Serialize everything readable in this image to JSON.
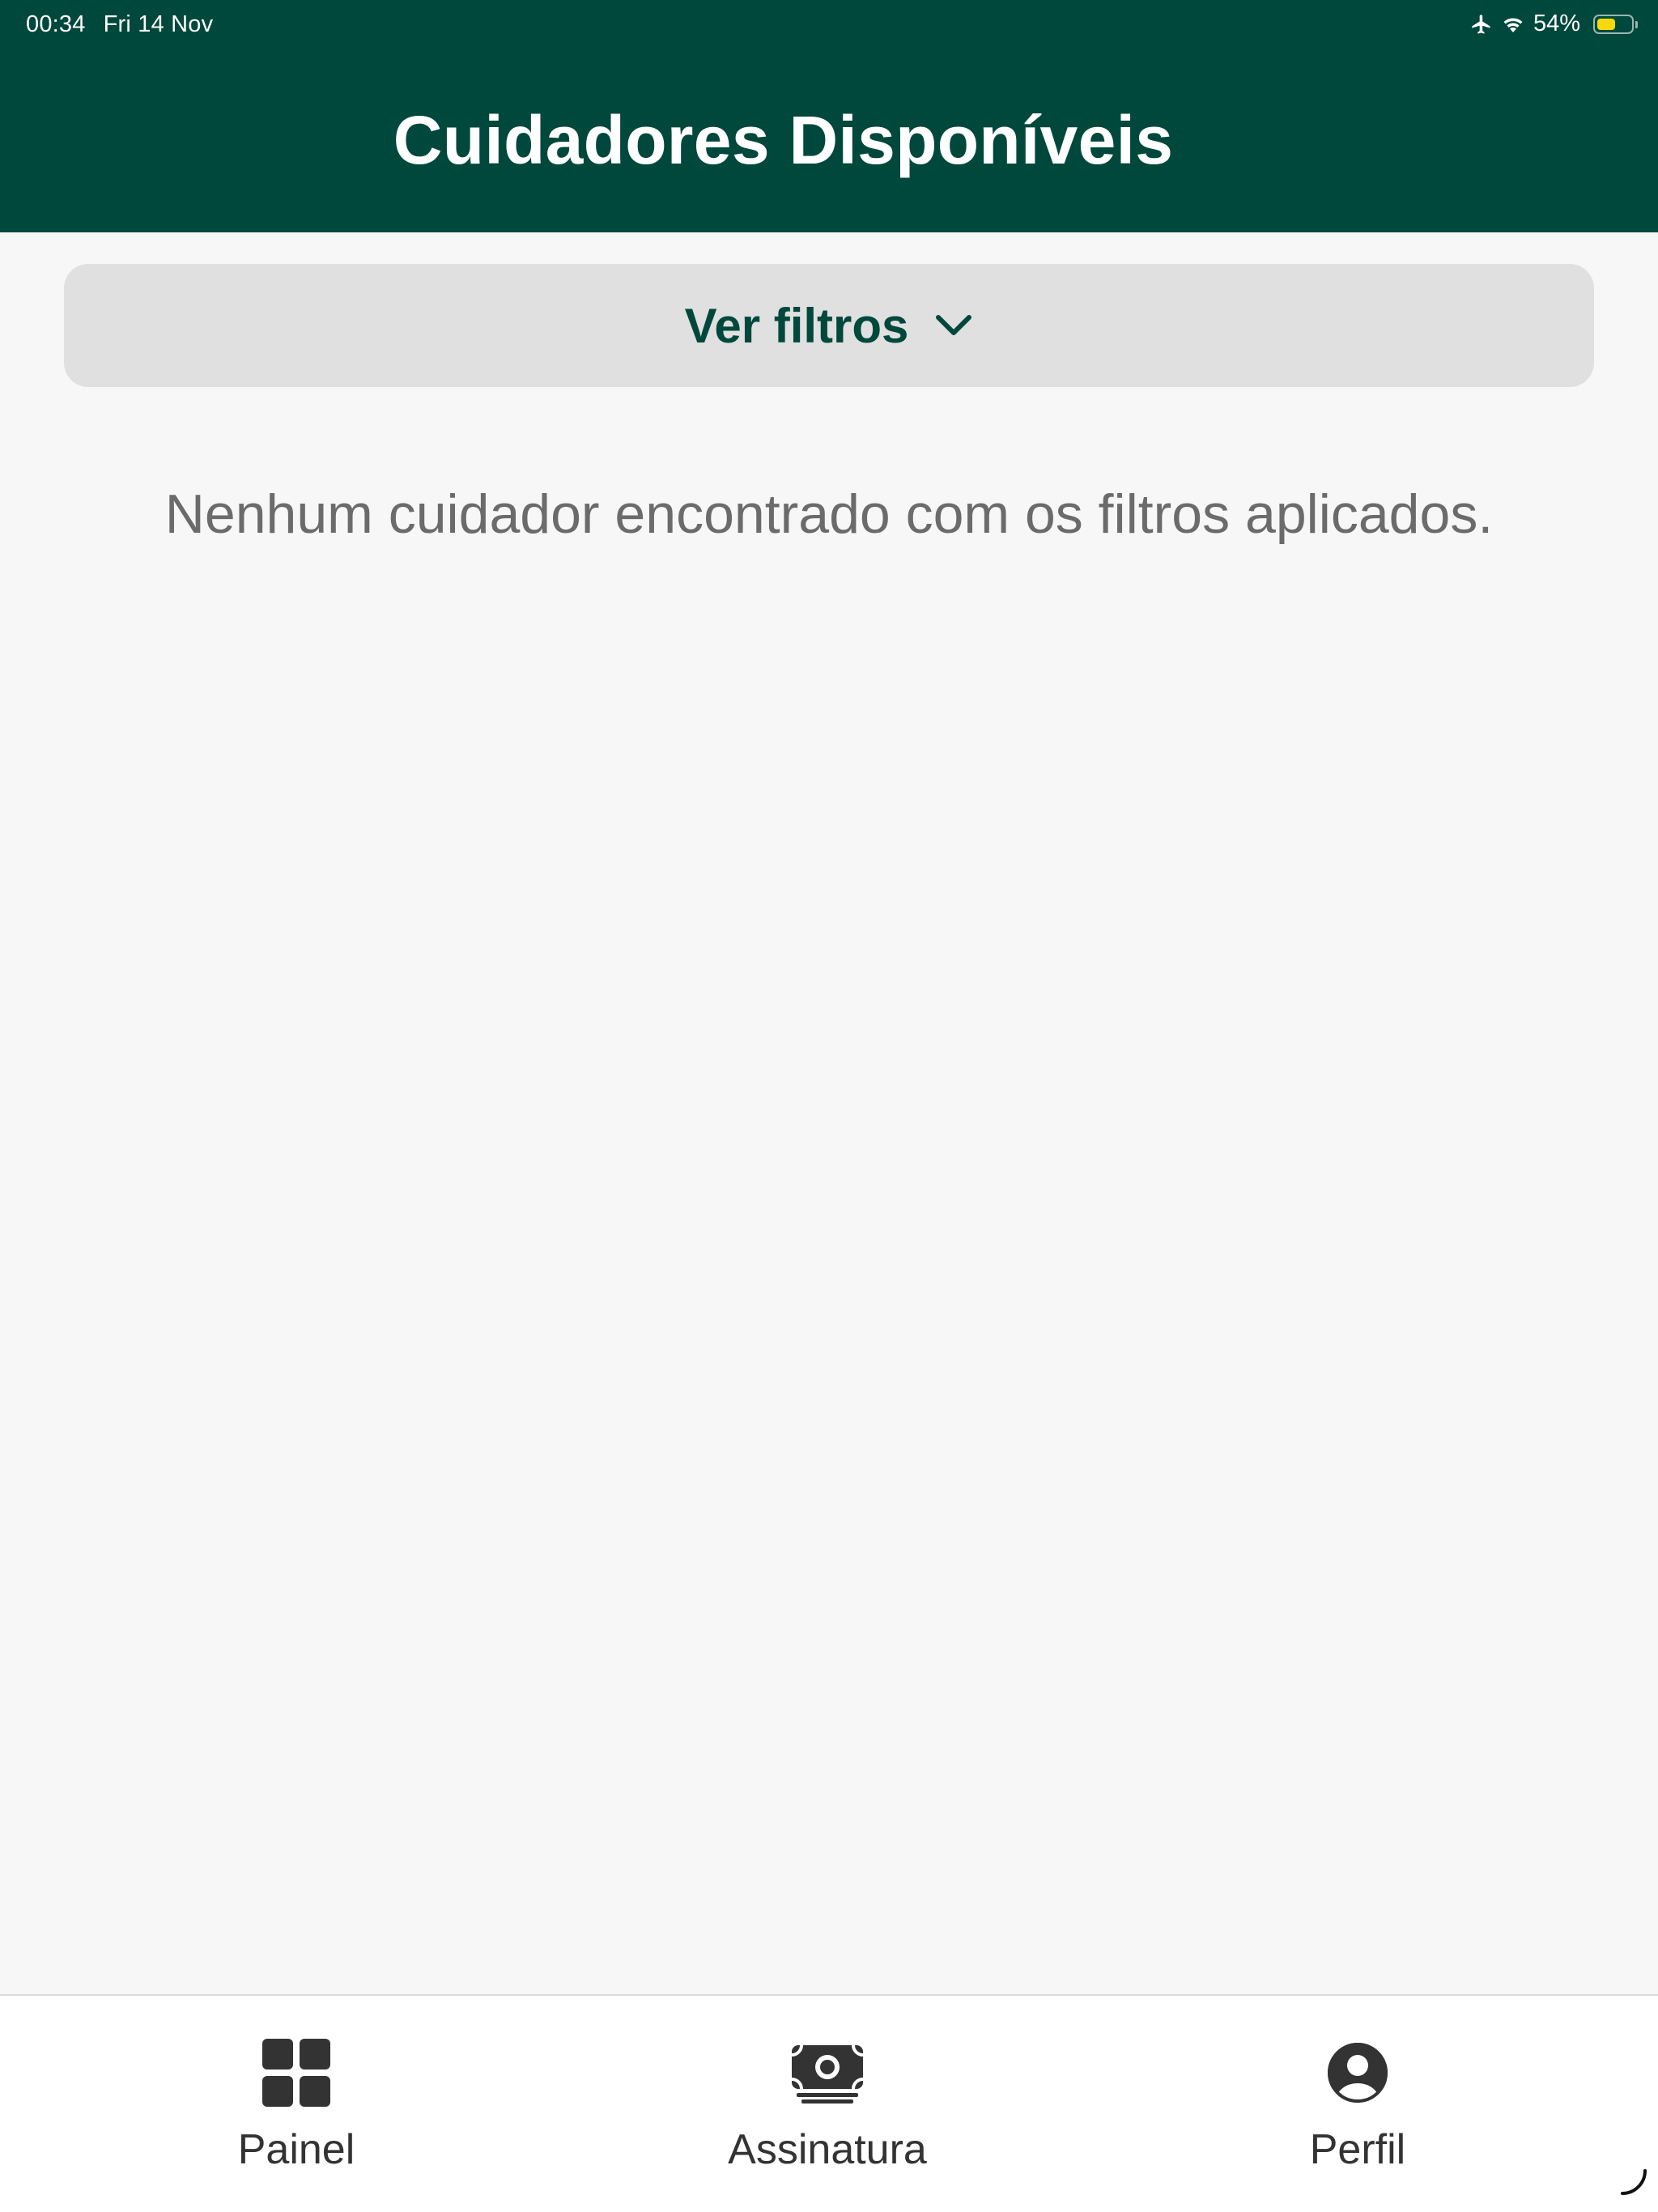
{
  "status_bar": {
    "time": "00:34",
    "date": "Fri 14 Nov",
    "battery_percent_text": "54%",
    "battery_level": 0.54,
    "icons": [
      "airplane-icon",
      "wifi-icon",
      "battery-icon"
    ]
  },
  "header": {
    "title": "Cuidadores Disponíveis",
    "background_color": "#00483c"
  },
  "filters": {
    "toggle_label": "Ver filtros",
    "icon": "chevron-down-icon"
  },
  "main": {
    "empty_message": "Nenhum cuidador encontrado com os filtros aplicados."
  },
  "tab_bar": {
    "items": [
      {
        "label": "Painel",
        "icon": "dashboard-grid-icon"
      },
      {
        "label": "Assinatura",
        "icon": "money-bill-icon"
      },
      {
        "label": "Perfil",
        "icon": "user-circle-icon"
      }
    ]
  },
  "colors": {
    "accent": "#00483c",
    "filter_bg": "#e0e0e0",
    "page_bg": "#f7f7f7",
    "muted_text": "#6b6b6b",
    "battery_fill": "#f5d90a"
  }
}
